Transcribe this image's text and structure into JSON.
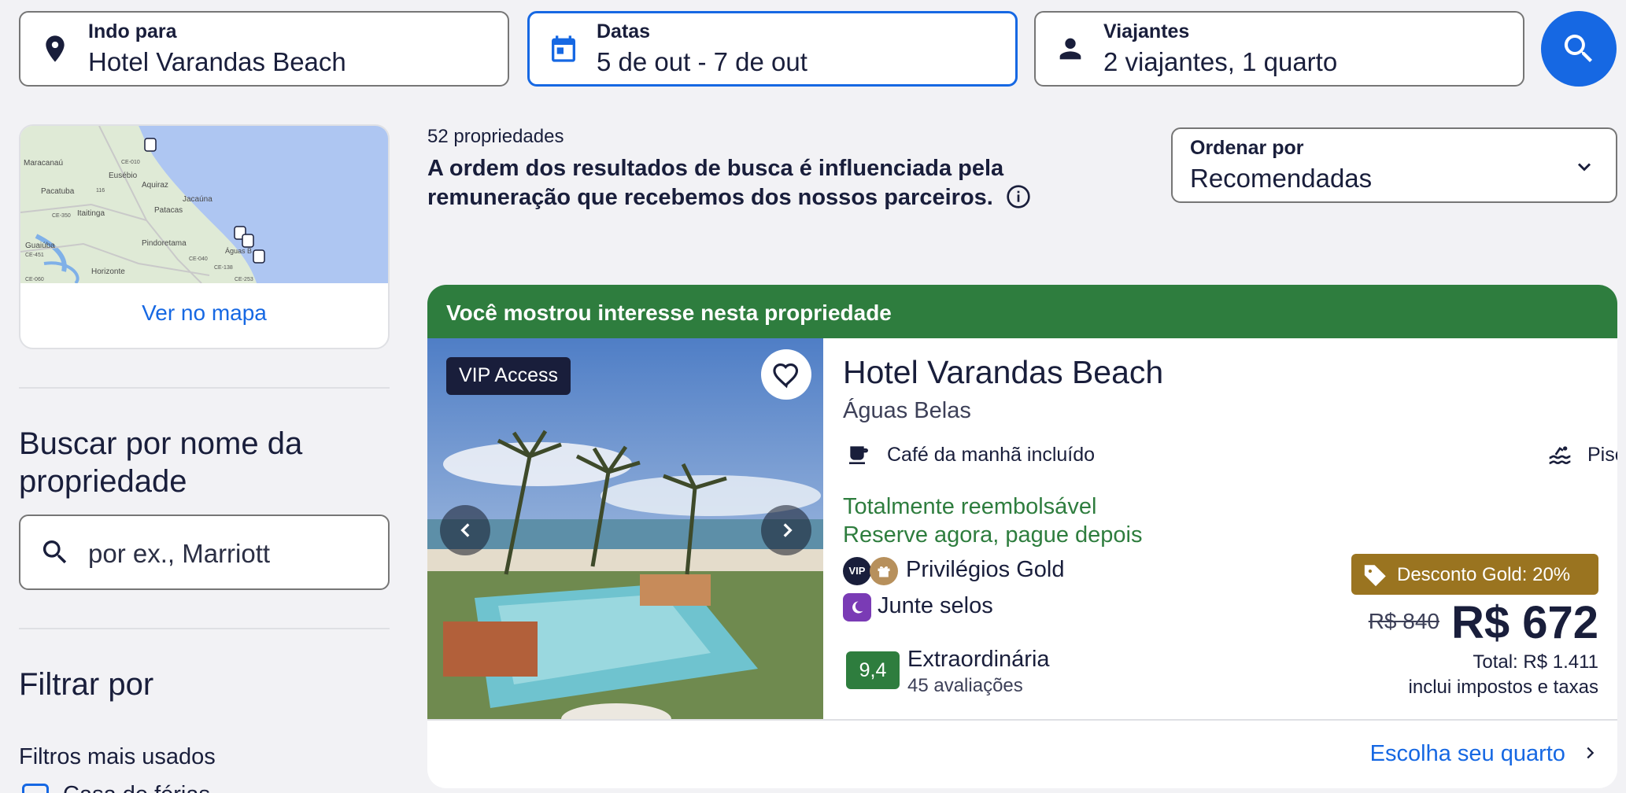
{
  "search": {
    "destination": {
      "label": "Indo para",
      "value": "Hotel Varandas Beach",
      "icon": "location-pin-icon"
    },
    "dates": {
      "label": "Datas",
      "value": "5 de out - 7 de out",
      "icon": "calendar-icon"
    },
    "travelers": {
      "label": "Viajantes",
      "value": "2 viajantes, 1 quarto",
      "icon": "person-icon"
    },
    "button_icon": "search-icon"
  },
  "map": {
    "link_label": "Ver no mapa",
    "place_labels": [
      "Maracanaú",
      "Eusébio",
      "Aquiraz",
      "Pacatuba",
      "Itaitinga",
      "Pindoretama",
      "Patacas",
      "Jacaúna",
      "Guaiúba",
      "Horizonte",
      "Águas B",
      "CE-010",
      "CE-040",
      "CE-138",
      "CE-350",
      "CE-451",
      "CE-060",
      "CE-253",
      "116"
    ]
  },
  "sidebar": {
    "name_search_title": "Buscar por nome da propriedade",
    "name_search_placeholder": "por ex., Marriott",
    "filter_title": "Filtrar por",
    "popular_filters_title": "Filtros mais usados",
    "first_filter_label": "Casa de férias"
  },
  "results": {
    "count": "52 propriedades",
    "disclaimer": "A ordem dos resultados de busca é influenciada pela remuneração que recebemos dos nossos parceiros.",
    "sort": {
      "label": "Ordenar por",
      "value": "Recomendadas"
    }
  },
  "property": {
    "banner": "Você mostrou interesse nesta propriedade",
    "vip_badge": "VIP Access",
    "name": "Hotel Varandas Beach",
    "location": "Águas Belas",
    "amenities": [
      {
        "label": "Café da manhã incluído",
        "icon": "coffee-cup-icon"
      },
      {
        "label": "Piscina",
        "icon": "pool-icon"
      }
    ],
    "refundable": "Totalmente reembolsável",
    "pay_later": "Reserve agora, pague depois",
    "gold_perks": "Privilégios Gold",
    "vip_mini": "VIP",
    "stamps": "Junte selos",
    "score": "9,4",
    "score_word": "Extraordinária",
    "reviews": "45 avaliações",
    "discount": "Desconto Gold: 20%",
    "price_old": "R$ 840",
    "price_now": "R$ 672",
    "price_total": "Total: R$ 1.411",
    "price_note": "inclui impostos e taxas",
    "cta": "Escolha seu quarto"
  },
  "colors": {
    "accent": "#1668e3",
    "banner_green": "#2e7d3e",
    "gold": "#9a7420",
    "text": "#191e3b"
  }
}
